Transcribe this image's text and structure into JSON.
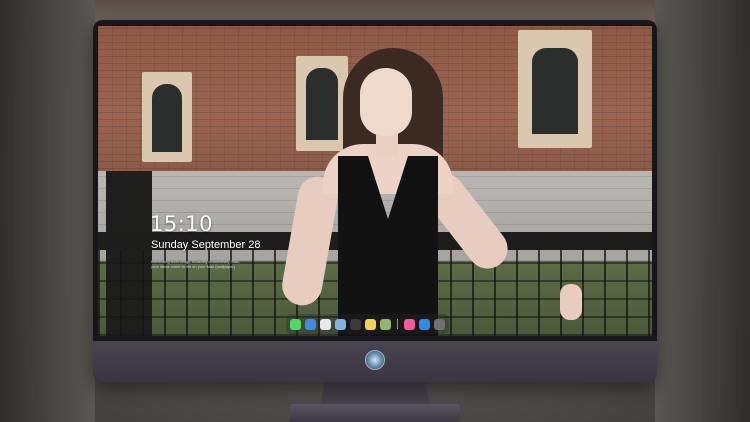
{
  "lock_screen": {
    "time": "15:10",
    "date": "Sunday September 28",
    "info_line_1": "Interesting technology. Amazing connectivity. Mac,",
    "info_line_2": "your ideas come to life on your Mac (wallpaper)"
  },
  "dock": {
    "icons": [
      {
        "name": "messages-icon",
        "color": "#4cd964"
      },
      {
        "name": "finder-icon",
        "color": "#3b8bea"
      },
      {
        "name": "safari-icon",
        "color": "#e8e8e8"
      },
      {
        "name": "preview-icon",
        "color": "#7fb2e5"
      },
      {
        "name": "video-icon",
        "color": "#3a3a3a"
      },
      {
        "name": "notes-icon",
        "color": "#f6d24a"
      },
      {
        "name": "photos-icon",
        "color": "#8fb86a"
      },
      {
        "name": "music-icon",
        "color": "#f25a9a"
      },
      {
        "name": "app-store-icon",
        "color": "#2d8cf0"
      },
      {
        "name": "camera-icon",
        "color": "#707070"
      }
    ]
  },
  "colors": {
    "bezel": "#3f3a45",
    "accent_text": "#ffffff"
  }
}
